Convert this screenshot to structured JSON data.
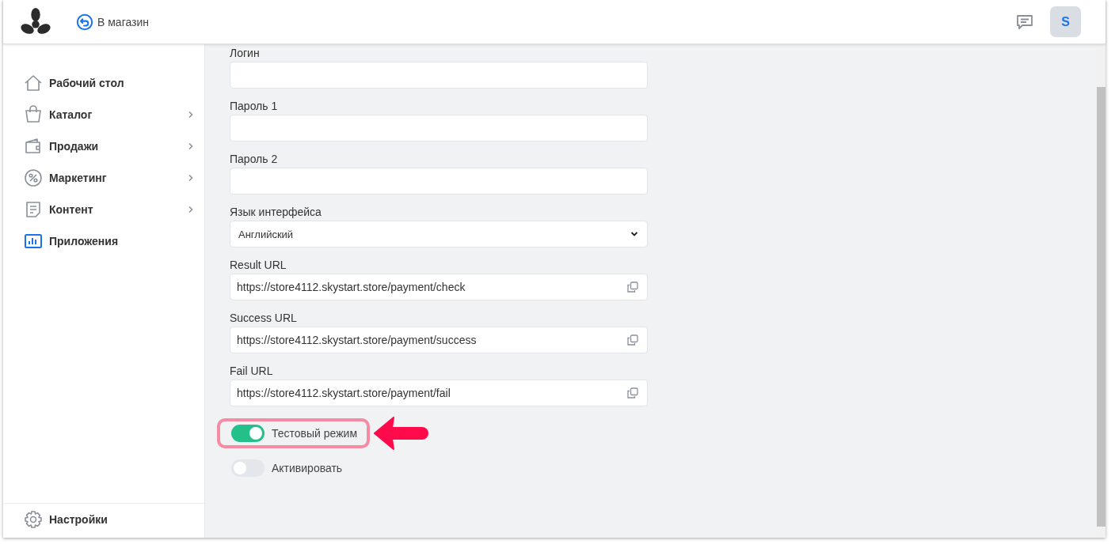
{
  "header": {
    "back_link": "В магазин",
    "avatar": "S"
  },
  "sidebar": {
    "items": [
      {
        "label": "Рабочий стол",
        "submenu": false,
        "selected": false
      },
      {
        "label": "Каталог",
        "submenu": true,
        "selected": false
      },
      {
        "label": "Продажи",
        "submenu": true,
        "selected": false
      },
      {
        "label": "Маркетинг",
        "submenu": true,
        "selected": false
      },
      {
        "label": "Контент",
        "submenu": true,
        "selected": false
      },
      {
        "label": "Приложения",
        "submenu": false,
        "selected": true
      }
    ],
    "footer": {
      "label": "Настройки"
    }
  },
  "form": {
    "fields": [
      {
        "kind": "text",
        "label": "Логин"
      },
      {
        "kind": "text",
        "label": "Пароль 1"
      },
      {
        "kind": "text",
        "label": "Пароль 2"
      },
      {
        "kind": "select",
        "label": "Язык интерфейса",
        "value": "Английский"
      },
      {
        "kind": "copy",
        "label": "Result URL",
        "value": "https://store4112.skystart.store/payment/check"
      },
      {
        "kind": "copy",
        "label": "Success URL",
        "value": "https://store4112.skystart.store/payment/success"
      },
      {
        "kind": "copy",
        "label": "Fail URL",
        "value": "https://store4112.skystart.store/payment/fail"
      }
    ],
    "toggles": [
      {
        "label": "Тестовый режим",
        "on": true,
        "highlighted": true
      },
      {
        "label": "Активировать",
        "on": false,
        "highlighted": false
      }
    ]
  }
}
